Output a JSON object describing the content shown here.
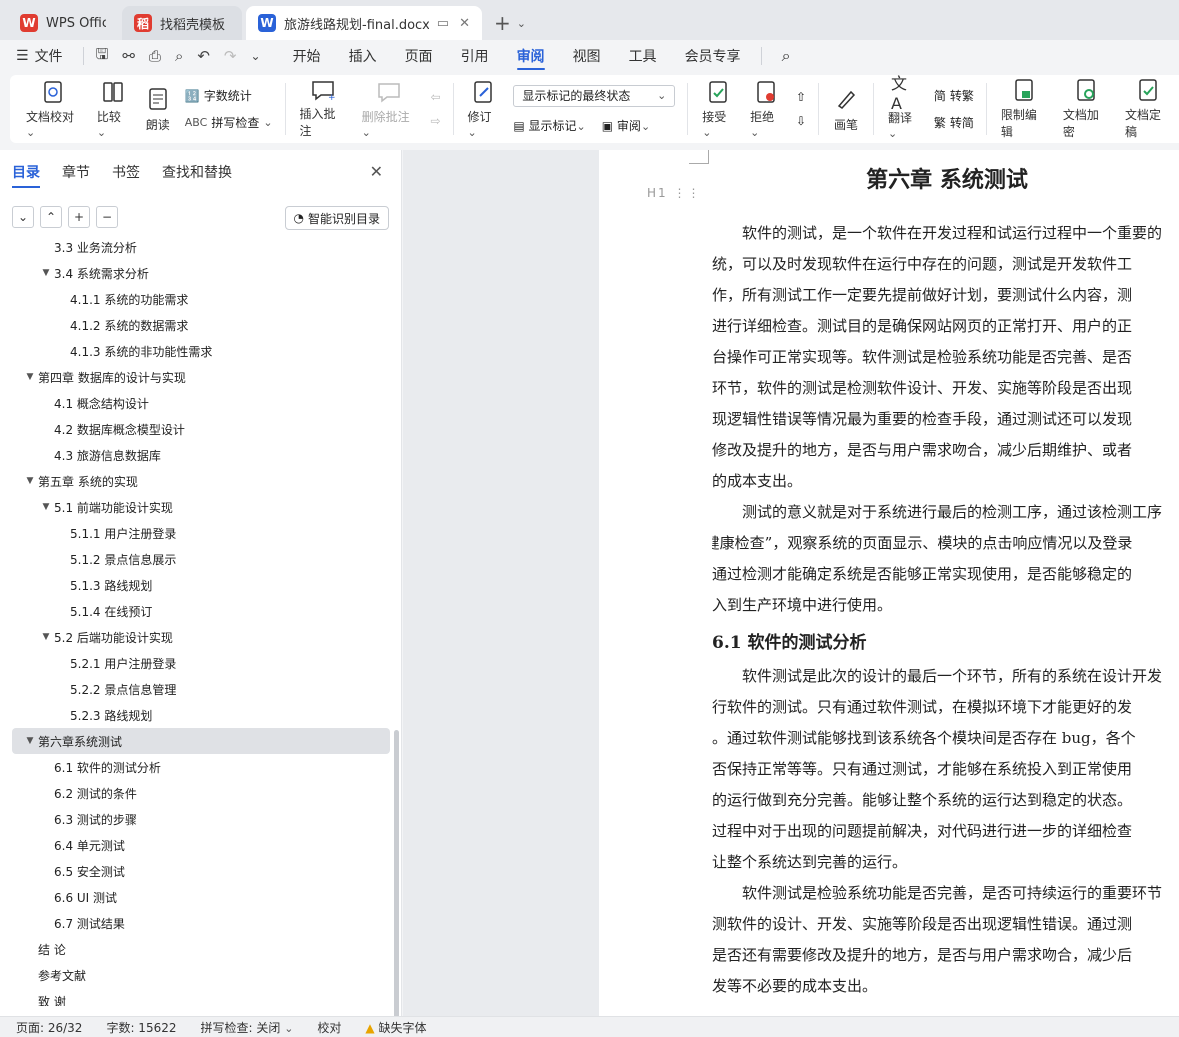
{
  "tabs": [
    {
      "label": "WPS Office",
      "icon": "wps-logo-icon",
      "color": "#e03c31"
    },
    {
      "label": "找稻壳模板",
      "icon": "docer-logo-icon",
      "color": "#e03c31"
    },
    {
      "label": "旅游线路规划-final.docx",
      "icon": "word-doc-icon",
      "color": "#2a62d8"
    }
  ],
  "menu": {
    "file": "文件",
    "items": [
      "开始",
      "插入",
      "页面",
      "引用",
      "审阅",
      "视图",
      "工具",
      "会员专享"
    ],
    "active": "审阅"
  },
  "ribbon": {
    "doc_check": "文档校对",
    "compare": "比较",
    "read_aloud": "朗读",
    "word_count": "字数统计",
    "spell_check": "拼写检查",
    "insert_comment": "插入批注",
    "delete_comment": "删除批注",
    "track": "修订",
    "markup_select": "显示标记的最终状态",
    "show_markup": "显示标记",
    "review_pane": "审阅",
    "accept": "接受",
    "reject": "拒绝",
    "pen": "画笔",
    "translate": "翻译",
    "trad": "转繁",
    "simp": "转简",
    "restrict": "限制编辑",
    "encrypt": "文档加密",
    "finalize": "文档定稿"
  },
  "nav": {
    "tabs": [
      "目录",
      "章节",
      "书签",
      "查找和替换"
    ],
    "smart_toc": "智能识别目录",
    "toc": [
      {
        "label": "3.3 业务流分析",
        "level": 2,
        "caret": false
      },
      {
        "label": "3.4 系统需求分析",
        "level": 2,
        "caret": true
      },
      {
        "label": "4.1.1 系统的功能需求",
        "level": 3,
        "caret": false
      },
      {
        "label": "4.1.2 系统的数据需求",
        "level": 3,
        "caret": false
      },
      {
        "label": "4.1.3 系统的非功能性需求",
        "level": 3,
        "caret": false
      },
      {
        "label": "第四章 数据库的设计与实现",
        "level": 1,
        "caret": true
      },
      {
        "label": "4.1 概念结构设计",
        "level": 2,
        "caret": false
      },
      {
        "label": "4.2 数据库概念模型设计",
        "level": 2,
        "caret": false
      },
      {
        "label": "4.3 旅游信息数据库",
        "level": 2,
        "caret": false
      },
      {
        "label": "第五章 系统的实现",
        "level": 1,
        "caret": true
      },
      {
        "label": "5.1 前端功能设计实现",
        "level": 2,
        "caret": true
      },
      {
        "label": "5.1.1 用户注册登录",
        "level": 3,
        "caret": false
      },
      {
        "label": "5.1.2 景点信息展示",
        "level": 3,
        "caret": false
      },
      {
        "label": "5.1.3 路线规划",
        "level": 3,
        "caret": false
      },
      {
        "label": "5.1.4 在线预订",
        "level": 3,
        "caret": false
      },
      {
        "label": "5.2 后端功能设计实现",
        "level": 2,
        "caret": true
      },
      {
        "label": "5.2.1 用户注册登录",
        "level": 3,
        "caret": false
      },
      {
        "label": "5.2.2 景点信息管理",
        "level": 3,
        "caret": false
      },
      {
        "label": "5.2.3 路线规划",
        "level": 3,
        "caret": false
      },
      {
        "label": "第六章系统测试",
        "level": 1,
        "caret": true,
        "selected": true
      },
      {
        "label": "6.1 软件的测试分析",
        "level": 2,
        "caret": false
      },
      {
        "label": "6.2 测试的条件",
        "level": 2,
        "caret": false
      },
      {
        "label": "6.3 测试的步骤",
        "level": 2,
        "caret": false
      },
      {
        "label": "6.4 单元测试",
        "level": 2,
        "caret": false
      },
      {
        "label": "6.5 安全测试",
        "level": 2,
        "caret": false
      },
      {
        "label": "6.6 UI 测试",
        "level": 2,
        "caret": false
      },
      {
        "label": "6.7 测试结果",
        "level": 2,
        "caret": false
      },
      {
        "label": "结  论",
        "level": 1,
        "caret": false
      },
      {
        "label": "参考文献",
        "level": 1,
        "caret": false
      },
      {
        "label": "致  谢",
        "level": 1,
        "caret": false
      }
    ]
  },
  "doc": {
    "chapter_title": "第六章 系统测试",
    "heading_marker": "H1",
    "p1": [
      "软件的测试，是一个软件在开发过程和试运行过程中一个重要的",
      "试系统，可以及时发现软件在运行中存在的问题，测试是开发软件工",
      "的工作，所有测试工作一定要先提前做好计划，要测试什么内容，测",
      "项目进行详细检查。测试目的是确保网站网页的正常打开、用户的正",
      "员后台操作可正常实现等。软件测试是检验系统功能是否完善、是否",
      "重要环节，软件的测试是检测软件设计、开发、实施等阶段是否出现",
      "件出现逻辑性错误等情况最为重要的检查手段，通过测试还可以发现",
      "需要修改及提升的地方，是否与用户需求吻合，减少后期维护、或者",
      "必要的成本支出。"
    ],
    "p2": [
      "测试的意义就是对于系统进行最后的检测工序，通过该检测工序",
      "次“健康检查”，观察系统的页面显示、模块的点击响应情况以及登录",
      "只有通过检测才能确定系统是否能够正常实现使用，是否能够稳定的",
      "以投入到生产环境中进行使用。"
    ],
    "section_title": "6.1 软件的测试分析",
    "p3": [
      "软件测试是此次的设计的最后一个环节，所有的系统在设计开发",
      "要进行软件的测试。只有通过软件测试，在模拟环境下才能更好的发",
      "与坏。通过软件测试能够找到该系统各个模块间是否存在 bug，各个",
      "态是否保持正常等等。只有通过测试，才能够在系统投入到正常使用",
      "系统的运行做到充分完善。能够让整个系统的运行达到稳定的状态。",
      "试的过程中对于出现的问题提前解决，对代码进行进一步的详细检查",
      "试能让整个系统达到完善的运行。"
    ],
    "p4": [
      "软件测试是检验系统功能是否完善，是否可持续运行的重要环节",
      "是检测软件的设计、开发、实施等阶段是否出现逻辑性错误。通过测",
      "软件是否还有需要修改及提升的地方，是否与用户需求吻合，减少后",
      "复开发等不必要的成本支出。"
    ]
  },
  "status": {
    "page": "页面: 26/32",
    "words": "字数: 15622",
    "spell": "拼写检查: 关闭",
    "proof": "校对",
    "missing_font": "缺失字体"
  }
}
